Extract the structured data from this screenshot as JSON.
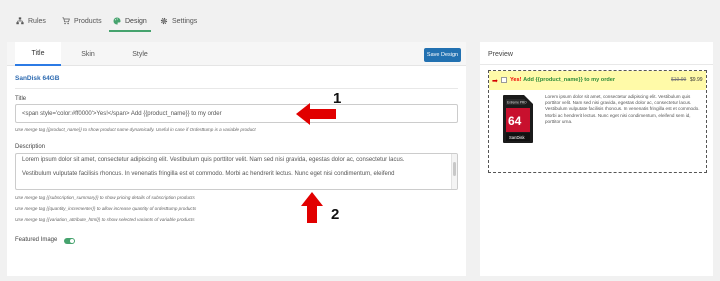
{
  "nav": {
    "tabs": [
      {
        "label": "Rules",
        "icon": "sitemap-icon"
      },
      {
        "label": "Products",
        "icon": "cart-icon"
      },
      {
        "label": "Design",
        "icon": "palette-icon"
      },
      {
        "label": "Settings",
        "icon": "gear-icon"
      }
    ],
    "active": "Design",
    "accent": "#46a36e"
  },
  "editor": {
    "subtabs": [
      "Title",
      "Skin",
      "Style"
    ],
    "active_subtab": "Title",
    "save_label": "Save Design",
    "product_name": "SanDisk 64GB",
    "title_label": "Title",
    "title_value": "<span style='color:#ff0000'>Yes!</span> Add {{product_name}} to my order",
    "title_hint": "Use merge tag {{product_name}} to show product name dynamically. Useful in case if OrderBump is a variable product",
    "description_label": "Description",
    "description_p1": "Lorem ipsum dolor sit amet, consectetur adipiscing elit. Vestibulum quis porttitor velit. Nam sed nisi gravida, egestas dolor ac, consectetur lacus.",
    "description_p2": "Vestibulum vulputate facilisis rhoncus. In venenatis fringilla est et commodo. Morbi ac hendrerit lectus. Nunc eget nisi condimentum, eleifend",
    "description_hints": [
      "Use merge tag {{subscription_summary}} to show pricing details of subscription products",
      "Use merge tag {{quantity_incrementer}} to allow increase quantity of orderBump products",
      "Use merge tag {{variation_attribute_html}} to show selected variants of variable products"
    ],
    "featured_image_label": "Featured Image",
    "featured_image_on": true
  },
  "preview": {
    "heading": "Preview",
    "arrow": "➡",
    "title_yes": "Yes!",
    "title_rest": "Add {{product_name}} to my order",
    "old_price": "$19.99",
    "new_price": "$9.99",
    "description": "Lorem ipsum dolor sit amet, consectetur adipiscing elit. Vestibulum quis porttitor velit. Nam sed nisi gravida, egestas dolor ac, consectetur lacus. Vestibulum vulputate facilisis rhoncus. In venenatis fringilla est et commodo. Morbi ac hendrerit lectus. Nunc eget nisi condimentum, eleifend sem id, porttitor urna.",
    "image_brand": "SanDisk",
    "image_capacity": "64",
    "image_series": "Extreme PRO",
    "bar_color": "#fffaa8"
  },
  "annotations": {
    "num1": "1",
    "num2": "2",
    "arrow_color": "#e10000"
  }
}
